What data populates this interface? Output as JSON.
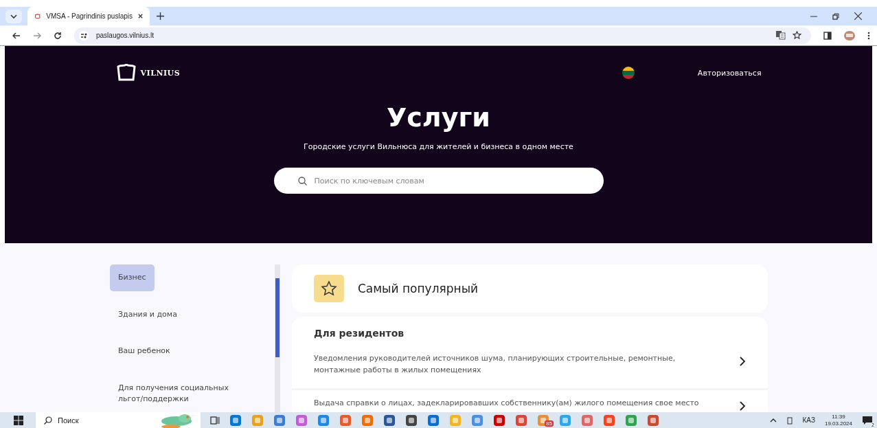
{
  "browser": {
    "tabs": [
      {
        "title": "VMSA - Pagrindinis puslapis",
        "selected": true
      }
    ],
    "url": "paslaugos.vilnius.lt"
  },
  "header": {
    "logo_text": "VILNIUS",
    "login": "Авторизоваться",
    "title": "Услуги",
    "subtitle": "Городские услуги Вильнюса для жителей и бизнеса в одном месте",
    "search": {
      "placeholder": "Поиск по ключевым словам"
    }
  },
  "sidebar": {
    "items": [
      {
        "label": "Бизнес",
        "selected": true
      },
      {
        "label": "Здания и дома",
        "selected": false
      },
      {
        "label": "Ваш ребенок",
        "selected": false
      },
      {
        "label": "Для получения социальных льгот/поддержки",
        "selected": false
      }
    ]
  },
  "popular": {
    "title": "Самый популярный"
  },
  "section": {
    "title": "Для резидентов",
    "services": [
      {
        "text": "Уведомления руководителей источников шума, планирующих строительные, ремонтные, монтажные работы в жилых помещениях"
      },
      {
        "text": "Выдача справки о лицах, задекларировавших собственнику(ам) жилого помещения свое место"
      }
    ]
  },
  "taskbar": {
    "search": {
      "placeholder": "Поиск"
    },
    "telegram_badge": "85",
    "language": "КАЗ",
    "time": "11:39",
    "date": "19.03.2024",
    "notifications": "2"
  }
}
